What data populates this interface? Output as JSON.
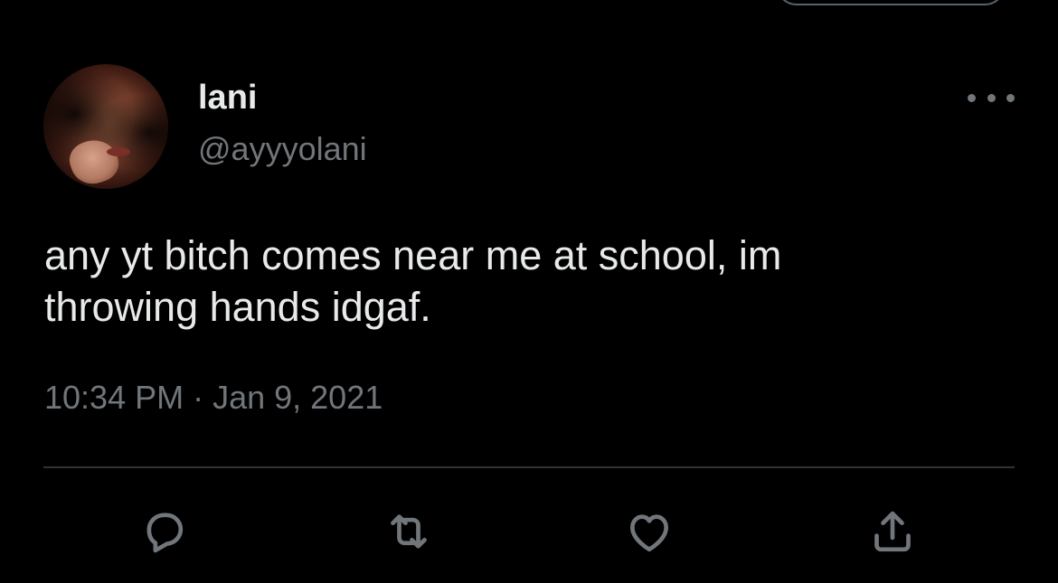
{
  "tweet": {
    "author": {
      "display_name": "lani",
      "handle": "@ayyyolani"
    },
    "text": "any yt bitch comes near me at school, im\nthrowing hands idgaf.",
    "timestamp": "10:34 PM · Jan 9, 2021"
  },
  "actions": {
    "reply_icon": "reply-icon",
    "retweet_icon": "retweet-icon",
    "like_icon": "like-icon",
    "share_icon": "share-icon"
  },
  "colors": {
    "background": "#000000",
    "primary_text": "#e7e9ea",
    "secondary_text": "#71767b",
    "divider": "#2f3336"
  }
}
